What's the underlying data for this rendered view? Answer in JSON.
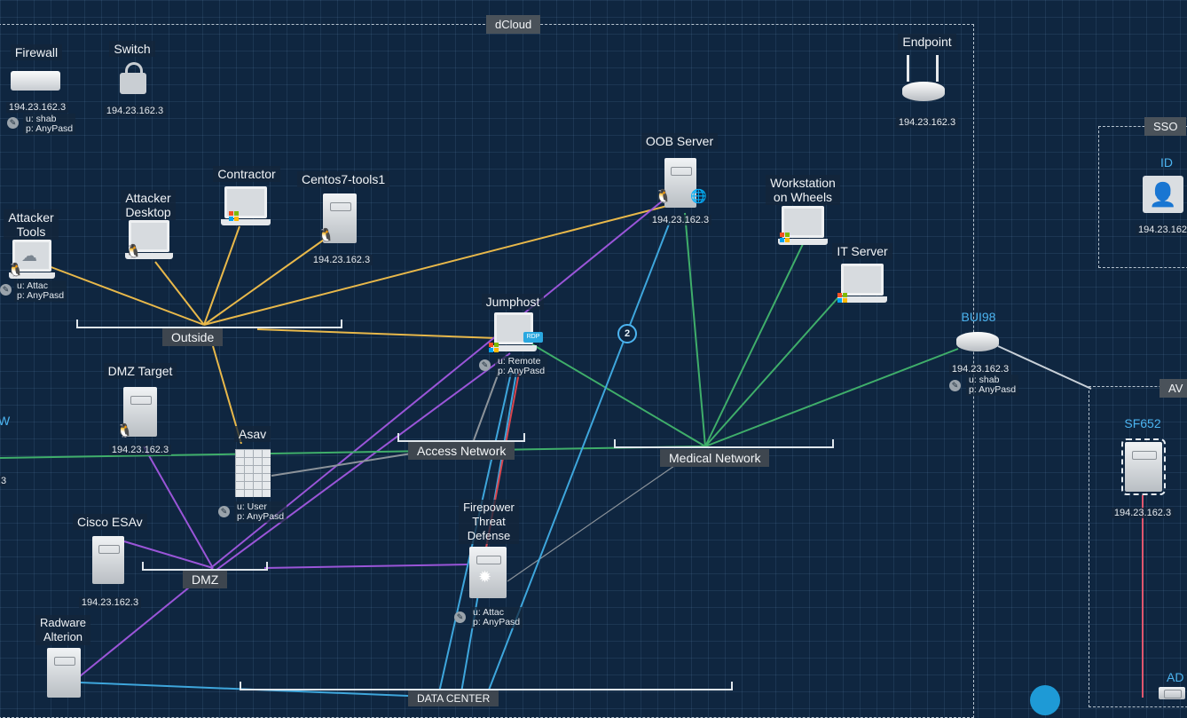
{
  "zones": {
    "dcloud": "dCloud",
    "sso": "SSO",
    "av": "AV"
  },
  "networks": {
    "outside": "Outside",
    "access": "Access Network",
    "medical": "Medical Network",
    "dmz": "DMZ",
    "datacenter": "DATA CENTER"
  },
  "nodes": {
    "firewall": {
      "label": "Firewall",
      "ip": "194.23.162.3",
      "user": "u: shab",
      "pass": "p: AnyPasd"
    },
    "switch": {
      "label": "Switch",
      "ip": "194.23.162.3"
    },
    "endpoint": {
      "label": "Endpoint",
      "ip": "194.23.162.3"
    },
    "oob_server": {
      "label": "OOB Server",
      "ip": "194.23.162.3"
    },
    "contractor": {
      "label": "Contractor"
    },
    "centos": {
      "label": "Centos7-tools1",
      "ip": "194.23.162.3"
    },
    "attacker_desktop": {
      "label": "Attacker\nDesktop"
    },
    "attacker_tools": {
      "label": "Attacker\nTools",
      "user": "u: Attac",
      "pass": "p: AnyPasd"
    },
    "workstation": {
      "label": "Workstation\non Wheels"
    },
    "it_server": {
      "label": "IT Server"
    },
    "jumphost": {
      "label": "Jumphost",
      "user": "u: Remote",
      "pass": "p: AnyPasd",
      "rdp": "RDP"
    },
    "bui98": {
      "label": "BUI98",
      "ip": "194.23.162.3",
      "user": "u: shab",
      "pass": "p: AnyPasd"
    },
    "id": {
      "label": "ID",
      "ip": "194.23.162"
    },
    "dmz_target": {
      "label": "DMZ Target",
      "ip": "194.23.162.3"
    },
    "asav": {
      "label": "Asav",
      "user": "u: User",
      "pass": "p: AnyPasd"
    },
    "sf652": {
      "label": "SF652",
      "ip": "194.23.162.3"
    },
    "left_edge": {
      "label": "W",
      "ip": ".3"
    },
    "cisco_esav": {
      "label": "Cisco ESAv",
      "ip": "194.23.162.3"
    },
    "firepower": {
      "label": "Firepower\nThreat\nDefense",
      "user": "u: Attac",
      "pass": "p: AnyPasd"
    },
    "radware": {
      "label": "Radware\nAlterion"
    },
    "ad": {
      "label": "AD"
    }
  },
  "badge_count": "2",
  "icons": [
    "linux-icon",
    "windows-icon",
    "wrench-icon",
    "globe-icon",
    "cloud-icon",
    "lock-icon",
    "router-icon",
    "server-icon",
    "laptop-icon"
  ],
  "colors": {
    "background": "#0f2640",
    "outside_link": "#e8b84a",
    "dmz_link": "#9a55d8",
    "medical_link": "#3fae6a",
    "datacenter_link": "#3ea6dc",
    "red_link": "#d8464e",
    "label_blue": "#4cb4f0"
  }
}
